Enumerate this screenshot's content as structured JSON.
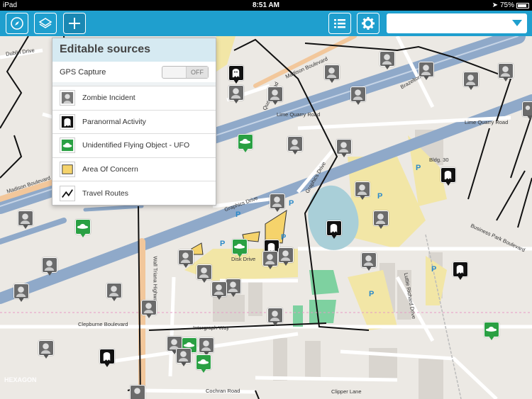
{
  "status_bar": {
    "device": "iPad",
    "time": "8:51 AM",
    "battery": "75%",
    "battery_level": 0.75
  },
  "toolbar": {
    "left_buttons": [
      "compass-icon",
      "layers-icon",
      "plus-icon"
    ],
    "right_buttons": [
      "list-icon",
      "gear-icon"
    ],
    "search_value": ""
  },
  "popover": {
    "title": "Editable sources",
    "gps_label": "GPS Capture",
    "gps_state": "OFF",
    "sources": [
      {
        "label": "Zombie Incident",
        "icon": "zombie-icon"
      },
      {
        "label": "Paranormal Activity",
        "icon": "ghost-icon"
      },
      {
        "label": "Unidentified Flying Object - UFO",
        "icon": "ufo-icon"
      },
      {
        "label": "Area Of Concern",
        "icon": "area-icon"
      },
      {
        "label": "Travel Routes",
        "icon": "route-icon"
      }
    ]
  },
  "map": {
    "streets": [
      "Dublin Drive",
      "Madison Boulevard",
      "Quarry Road",
      "Lime Quarry Road",
      "Brazelton",
      "Graphics Drive",
      "Disk Drive",
      "Wall Triana Highway",
      "Intergraph Way",
      "Clepburne Boulevard",
      "Clipper Lane",
      "Cochran Road",
      "Business Park Boulevard",
      "Luttie Richard Drive",
      "Lime Quarry Road",
      "Bldg. 30",
      "Madison Boulevard",
      "Graphics Drive"
    ],
    "parking_label": "P",
    "watermark": "HEXAGON"
  },
  "colors": {
    "toolbar": "#1f9fce",
    "popover_header": "#d6eaf2",
    "ufo": "#2aa043",
    "area": "#f5d36b"
  }
}
